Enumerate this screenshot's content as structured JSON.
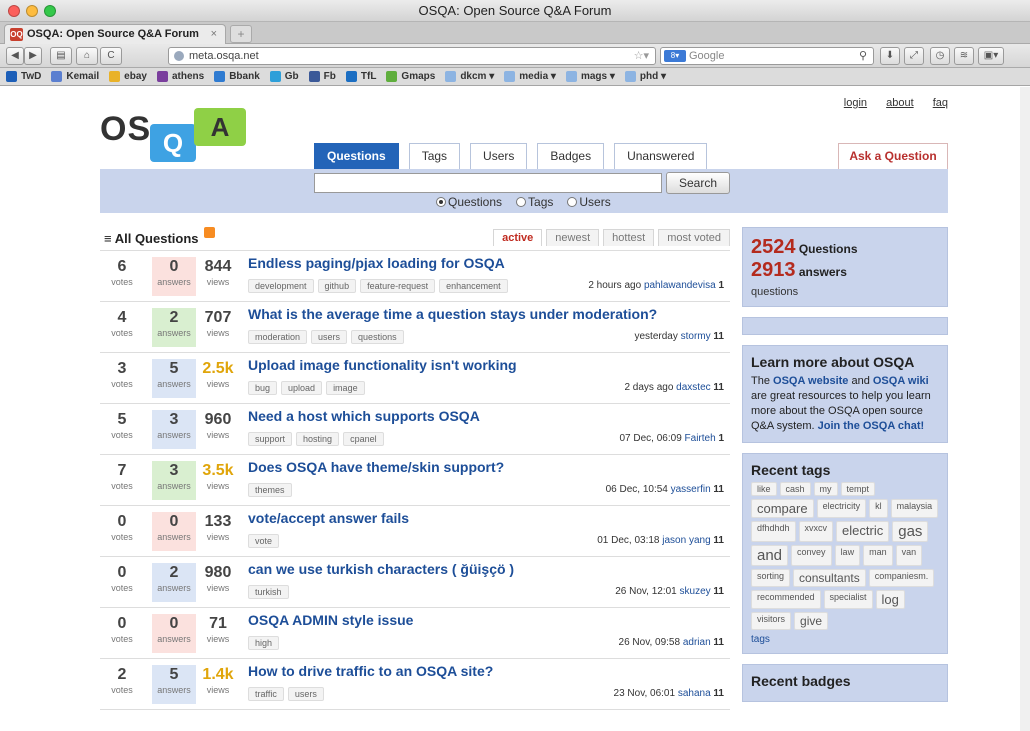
{
  "window": {
    "title": "OSQA: Open Source Q&A Forum"
  },
  "tab": {
    "label": "OSQA: Open Source Q&A Forum",
    "favicon": "OQ",
    "close": "×",
    "new": "+"
  },
  "nav": {
    "back": "◀",
    "fwd": "▶",
    "home": "⌂",
    "reload": "C",
    "url": "meta.osqa.net",
    "search_engine": "Google",
    "search_engine_icon": "8▾"
  },
  "bookmarks": [
    {
      "label": "TwD",
      "color": "#1d5fb8"
    },
    {
      "label": "Kemail",
      "color": "#5b7fd0"
    },
    {
      "label": "ebay",
      "color": "#e9b229"
    },
    {
      "label": "athens",
      "color": "#7a3e9d"
    },
    {
      "label": "Bbank",
      "color": "#2f7bd1"
    },
    {
      "label": "Gb",
      "color": "#2d9fd9"
    },
    {
      "label": "Fb",
      "color": "#3b5998"
    },
    {
      "label": "TfL",
      "color": "#1b6ec2"
    },
    {
      "label": "Gmaps",
      "color": "#5fae3d"
    },
    {
      "label": "dkcm ▾",
      "color": "#8db4e2"
    },
    {
      "label": "media ▾",
      "color": "#8db4e2"
    },
    {
      "label": "mags ▾",
      "color": "#8db4e2"
    },
    {
      "label": "phd ▾",
      "color": "#8db4e2"
    }
  ],
  "site": {
    "logo": {
      "os": "OS",
      "q": "Q",
      "a": "A"
    },
    "toplinks": [
      "login",
      "about",
      "faq"
    ],
    "tabs": [
      "Questions",
      "Tags",
      "Users",
      "Badges",
      "Unanswered"
    ],
    "ask": "Ask a Question",
    "search_button": "Search",
    "radios": [
      "Questions",
      "Tags",
      "Users"
    ]
  },
  "list": {
    "title": "All Questions",
    "sorts": [
      "active",
      "newest",
      "hottest",
      "most voted"
    ],
    "questions": [
      {
        "votes": "6",
        "answers": "0",
        "views": "844",
        "title": "Endless paging/pjax loading for OSQA",
        "tags": [
          "development",
          "github",
          "feature-request",
          "enhancement"
        ],
        "time": "2 hours ago",
        "user": "pahlawandevisa",
        "rep": "1"
      },
      {
        "votes": "4",
        "answers": "2",
        "views": "707",
        "title": "What is the average time a question stays under moderation?",
        "tags": [
          "moderation",
          "users",
          "questions"
        ],
        "time": "yesterday",
        "user": "stormy",
        "rep": "11"
      },
      {
        "votes": "3",
        "answers": "5",
        "views": "2.5k",
        "title": "Upload image functionality isn't working",
        "tags": [
          "bug",
          "upload",
          "image"
        ],
        "time": "2 days ago",
        "user": "daxstec",
        "rep": "11"
      },
      {
        "votes": "5",
        "answers": "3",
        "views": "960",
        "title": "Need a host which supports OSQA",
        "tags": [
          "support",
          "hosting",
          "cpanel"
        ],
        "time": "07 Dec, 06:09",
        "user": "Fairteh",
        "rep": "1"
      },
      {
        "votes": "7",
        "answers": "3",
        "views": "3.5k",
        "title": "Does OSQA have theme/skin support?",
        "tags": [
          "themes"
        ],
        "time": "06 Dec, 10:54",
        "user": "yasserfin",
        "rep": "11"
      },
      {
        "votes": "0",
        "answers": "0",
        "views": "133",
        "title": "vote/accept answer fails",
        "tags": [
          "vote"
        ],
        "time": "01 Dec, 03:18",
        "user": "jason yang",
        "rep": "11"
      },
      {
        "votes": "0",
        "answers": "2",
        "views": "980",
        "title": "can we use turkish characters ( ğüişçö )",
        "tags": [
          "turkish"
        ],
        "time": "26 Nov, 12:01",
        "user": "skuzey",
        "rep": "11"
      },
      {
        "votes": "0",
        "answers": "0",
        "views": "71",
        "title": "OSQA ADMIN style issue",
        "tags": [
          "high"
        ],
        "time": "26 Nov, 09:58",
        "user": "adrian",
        "rep": "11"
      },
      {
        "votes": "2",
        "answers": "5",
        "views": "1.4k",
        "title": "How to drive traffic to an OSQA site?",
        "tags": [
          "traffic",
          "users"
        ],
        "time": "23 Nov, 06:01",
        "user": "sahana",
        "rep": "11"
      }
    ],
    "labels": {
      "votes": "votes",
      "answers": "answers",
      "views": "views"
    }
  },
  "sidebar": {
    "questions_count": "2524",
    "questions_label": "Questions",
    "answers_count": "2913",
    "answers_label": "answers",
    "unanswered_label": "questions",
    "learn_title": "Learn more about OSQA",
    "learn_text_1": "The ",
    "learn_link_1": "OSQA website",
    "learn_text_2": " and ",
    "learn_link_2": "OSQA wiki",
    "learn_text_3": " are great resources to help you learn more about the OSQA open source Q&A system. ",
    "learn_link_3": "Join the OSQA chat!",
    "recent_tags_title": "Recent tags",
    "tags": [
      {
        "t": "like",
        "s": 9
      },
      {
        "t": "cash",
        "s": 9
      },
      {
        "t": "my",
        "s": 9
      },
      {
        "t": "tempt",
        "s": 9
      },
      {
        "t": "compare",
        "s": 13
      },
      {
        "t": "electricity",
        "s": 9
      },
      {
        "t": "kl",
        "s": 9
      },
      {
        "t": "malaysia",
        "s": 9
      },
      {
        "t": "dfhdhdh",
        "s": 9
      },
      {
        "t": "xvxcv",
        "s": 9
      },
      {
        "t": "electric",
        "s": 13
      },
      {
        "t": "gas",
        "s": 15
      },
      {
        "t": "and",
        "s": 15
      },
      {
        "t": "convey",
        "s": 9
      },
      {
        "t": "law",
        "s": 9
      },
      {
        "t": "man",
        "s": 9
      },
      {
        "t": "van",
        "s": 9
      },
      {
        "t": "sorting",
        "s": 9
      },
      {
        "t": "consultants",
        "s": 12
      },
      {
        "t": "companiesm.",
        "s": 9
      },
      {
        "t": "recommended",
        "s": 9
      },
      {
        "t": "specialist",
        "s": 9
      },
      {
        "t": "log",
        "s": 13
      },
      {
        "t": "visitors",
        "s": 9
      },
      {
        "t": "give",
        "s": 12
      }
    ],
    "tags_link": "tags",
    "recent_badges_title": "Recent badges"
  }
}
